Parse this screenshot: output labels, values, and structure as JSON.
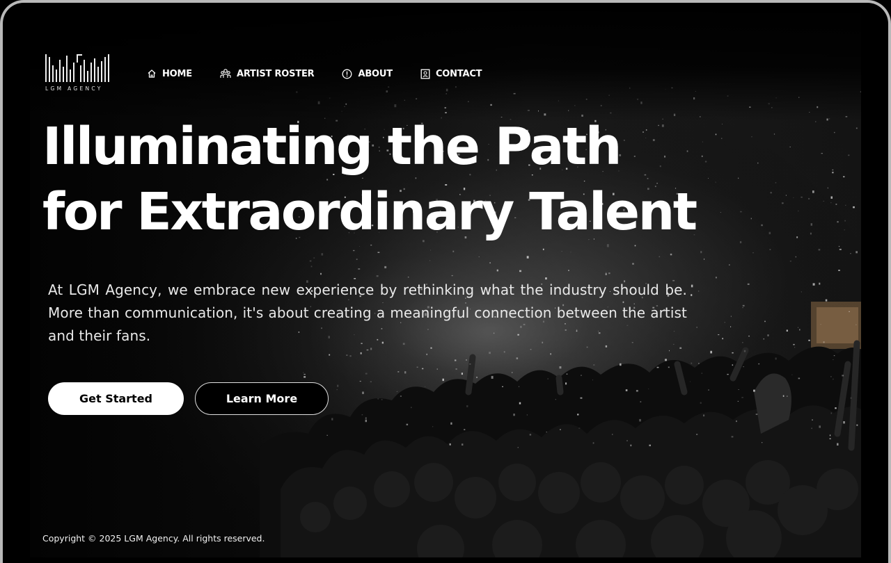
{
  "brand": {
    "name": "LGM AGENCY"
  },
  "nav": {
    "items": [
      {
        "label": "HOME",
        "icon": "home-icon"
      },
      {
        "label": "ARTIST ROSTER",
        "icon": "users-icon"
      },
      {
        "label": "ABOUT",
        "icon": "info-circle-icon"
      },
      {
        "label": "CONTACT",
        "icon": "contact-card-icon"
      }
    ]
  },
  "hero": {
    "headline_line1": "Illuminating the Path",
    "headline_line2": "for Extraordinary Talent",
    "intro": "At LGM Agency, we embrace new experience by rethinking what the industry should be. More than communication, it's about creating a meaningful connection between the artist and their fans.",
    "primary_button": "Get Started",
    "secondary_button": "Learn More",
    "background": "concert-crowd-photo"
  },
  "footer": {
    "copyright": "Copyright © 2025 LGM Agency. All rights reserved."
  },
  "colors": {
    "background": "#000000",
    "text": "#ffffff",
    "button_primary_bg": "#ffffff",
    "button_secondary_border": "#e0e0e0"
  }
}
